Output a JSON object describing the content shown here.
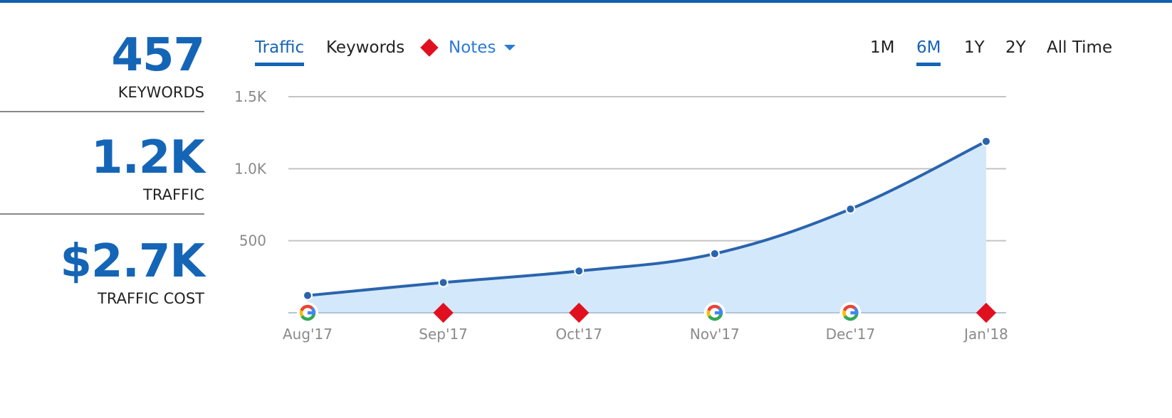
{
  "colors": {
    "brand": "#1565b7",
    "line": "#2a64ad",
    "area": "#d3e8fb",
    "note_red": "#e01020",
    "notes_link": "#2b7ad6",
    "grid": "#c4c4c4",
    "baseline": "#b0c4d8",
    "axis_text": "#8a8a8a"
  },
  "stats": [
    {
      "value": "457",
      "label": "KEYWORDS"
    },
    {
      "value": "1.2K",
      "label": "TRAFFIC"
    },
    {
      "value": "$2.7K",
      "label": "TRAFFIC COST"
    }
  ],
  "tabs": {
    "traffic": "Traffic",
    "keywords": "Keywords",
    "notes": "Notes",
    "active": "Traffic"
  },
  "ranges": {
    "items": [
      "1M",
      "6M",
      "1Y",
      "2Y",
      "All Time"
    ],
    "active": "6M"
  },
  "chart_data": {
    "type": "area",
    "title": "",
    "xlabel": "",
    "ylabel": "",
    "categories": [
      "Aug'17",
      "Sep'17",
      "Oct'17",
      "Nov'17",
      "Dec'17",
      "Jan'18"
    ],
    "series": [
      {
        "name": "Traffic",
        "values": [
          120,
          210,
          290,
          410,
          720,
          1190
        ]
      }
    ],
    "yticks": [
      {
        "value": 500,
        "label": "500"
      },
      {
        "value": 1000,
        "label": "1.0K"
      },
      {
        "value": 1500,
        "label": "1.5K"
      }
    ],
    "ylim": [
      0,
      1500
    ],
    "grid": true,
    "legend": "none",
    "markers": [
      "google",
      "note",
      "note",
      "google",
      "google",
      "note"
    ]
  }
}
